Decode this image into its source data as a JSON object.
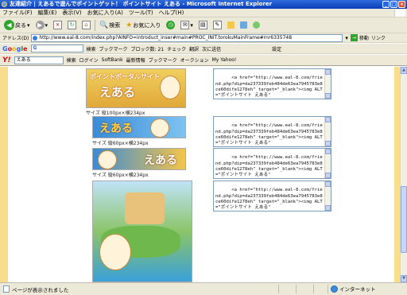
{
  "window": {
    "title": "友達紹介 | えあるで遊んでポイントゲット！ ポイントサイト えある - Microsoft Internet Explorer"
  },
  "menu": [
    "ファイル(F)",
    "編集(E)",
    "表示(V)",
    "お気に入り(A)",
    "ツール(T)",
    "ヘルプ(H)"
  ],
  "toolbar": {
    "back_label": "戻る",
    "search_label": "検索",
    "favorites_label": "お気に入り"
  },
  "address": {
    "label": "アドレス(D)",
    "url": "http://www.eal-8.com/index.php?AINFO=introduct_inser#main#PROC_INIT.torokuMainFrame#rnr6335748",
    "go_label": "移動",
    "links_label": "リンク"
  },
  "google": {
    "logo": "Google",
    "search_value": "G",
    "search_btn": "検索",
    "items": [
      "ブックマーク",
      "ブロック数: 21",
      "チェック",
      "翻訳",
      "次に送信",
      "設定"
    ]
  },
  "yahoo": {
    "logo": "Y!",
    "search_value": "えある",
    "search_btn": "検索",
    "items": [
      "ログイン",
      "SoftBank",
      "最新情報",
      "ブックマーク",
      "オークション",
      "My Yahoo!"
    ]
  },
  "banners": [
    {
      "label": "サイズ 縦100px×横234px",
      "code": "<a href=\"http://www.eal-8.com/friend.php?dip=da237339feb484de63ea7945783e8ce60dife1278eh\" target=\"_blank\"><img ALT=\"ポイントサイト えある\""
    },
    {
      "label": "サイズ 縦60px×横234px",
      "code": "<a href=\"http://www.eal-8.com/friend.php?dip=da237339feb484de63ea7945783e8ce60dife1278eh\" target=\"_blank\"><img ALT=\"ポイントサイト えある\""
    },
    {
      "label": "サイズ 縦60px×横234px",
      "code": "<a href=\"http://www.eal-8.com/friend.php?dip=da237339feb484de63ea7945783e8ce60dife1278eh\" target=\"_blank\"><img ALT=\"ポイントサイト えある\""
    },
    {
      "label": "",
      "code": "<a href=\"http://www.eal-8.com/friend.php?dip=da237339feb484de63ea7945783e8ce60dife1278eh\" target=\"_blank\"><img ALT=\"ポイントサイト えある\""
    }
  ],
  "banner_text": {
    "b1_title": "ポイントポータルサイト",
    "b1_name": "えある",
    "b2_name": "えある",
    "b3_name": "えある"
  },
  "status": {
    "text": "ページが表示されました",
    "zone": "インターネット"
  },
  "colors": {
    "page_bg": "#f7dd8c",
    "title_bar": "#0a3eb8"
  }
}
